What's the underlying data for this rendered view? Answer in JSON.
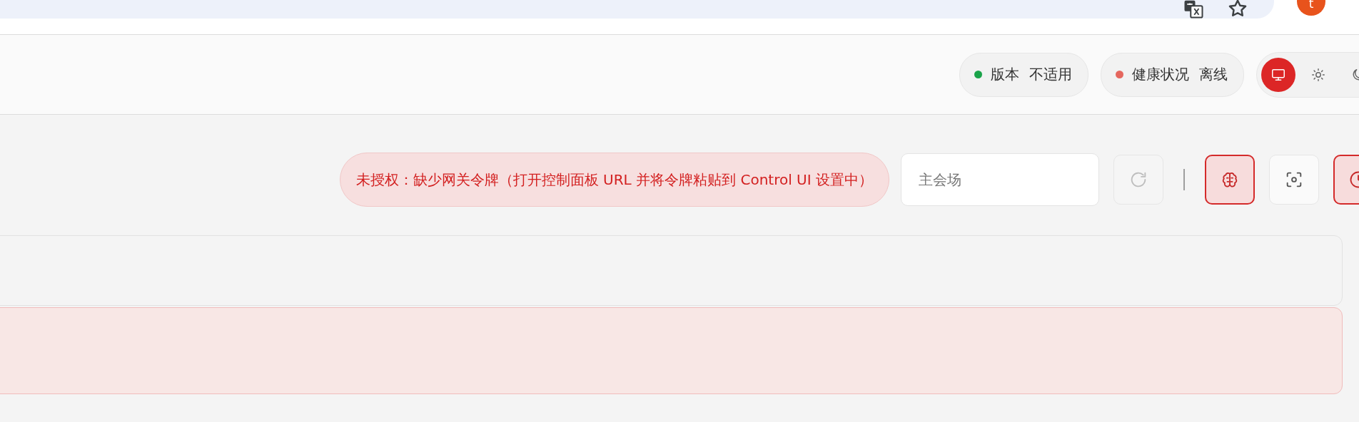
{
  "browser": {
    "avatar_letter": "t"
  },
  "header": {
    "status_pills": [
      {
        "label": "版本",
        "value": "不适用",
        "color": "#1aa34a"
      },
      {
        "label": "健康状况",
        "value": "离线",
        "color": "#e5675e"
      }
    ],
    "theme_options": [
      {
        "kind": "system",
        "selected": true
      },
      {
        "kind": "light",
        "selected": false
      },
      {
        "kind": "dark",
        "selected": false
      }
    ]
  },
  "toolbar": {
    "error": "未授权：缺少网关令牌（打开控制面板 URL 并将令牌粘贴到 Control UI 设置中）",
    "session_field": {
      "placeholder": "主会场"
    },
    "refresh": {
      "disabled": true
    },
    "tools": [
      {
        "kind": "brain",
        "active": true
      },
      {
        "kind": "focus",
        "active": false
      },
      {
        "kind": "clock",
        "active": true
      }
    ]
  },
  "panels": [
    {
      "kind": "plain"
    },
    {
      "kind": "error"
    }
  ]
}
